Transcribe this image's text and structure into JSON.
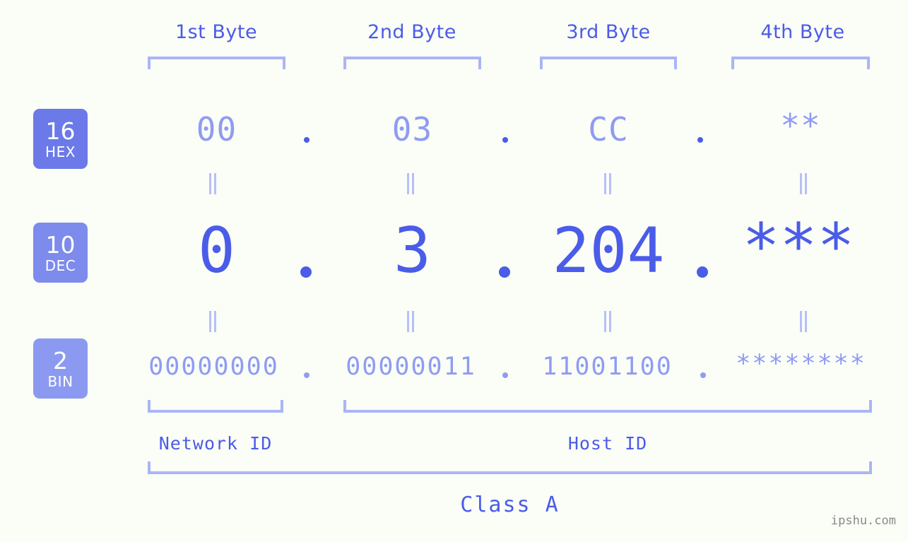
{
  "meta": {
    "background_color": "#fbfdf7",
    "accent_strong": "#4a5ce8",
    "accent_light": "#8f9cf2",
    "bracket_color": "#aab5f7",
    "badge_color": "#6b7ae8",
    "badge_color_light": "#8b9af0",
    "watermark_color": "#8a8a8a"
  },
  "header": {
    "byte_labels": [
      {
        "label": "1st Byte"
      },
      {
        "label": "2nd Byte"
      },
      {
        "label": "3rd Byte"
      },
      {
        "label": "4th Byte"
      }
    ]
  },
  "badges": [
    {
      "num": "16",
      "unit": "HEX"
    },
    {
      "num": "10",
      "unit": "DEC"
    },
    {
      "num": "2",
      "unit": "BIN"
    }
  ],
  "rows": {
    "hex": {
      "radix": "16",
      "radix_name": "HEX",
      "values": [
        "00",
        "03",
        "CC",
        "**"
      ],
      "separator": "."
    },
    "dec": {
      "radix": "10",
      "radix_name": "DEC",
      "values": [
        "0",
        "3",
        "204",
        "***"
      ],
      "separator": "."
    },
    "bin": {
      "radix": "2",
      "radix_name": "BIN",
      "values": [
        "00000000",
        "00000011",
        "11001100",
        "********"
      ],
      "separator": "."
    }
  },
  "equals_symbol": "=",
  "footer": {
    "network_id_label": "Network ID",
    "host_id_label": "Host ID",
    "class_label": "Class A"
  },
  "watermark": "ipshu.com"
}
